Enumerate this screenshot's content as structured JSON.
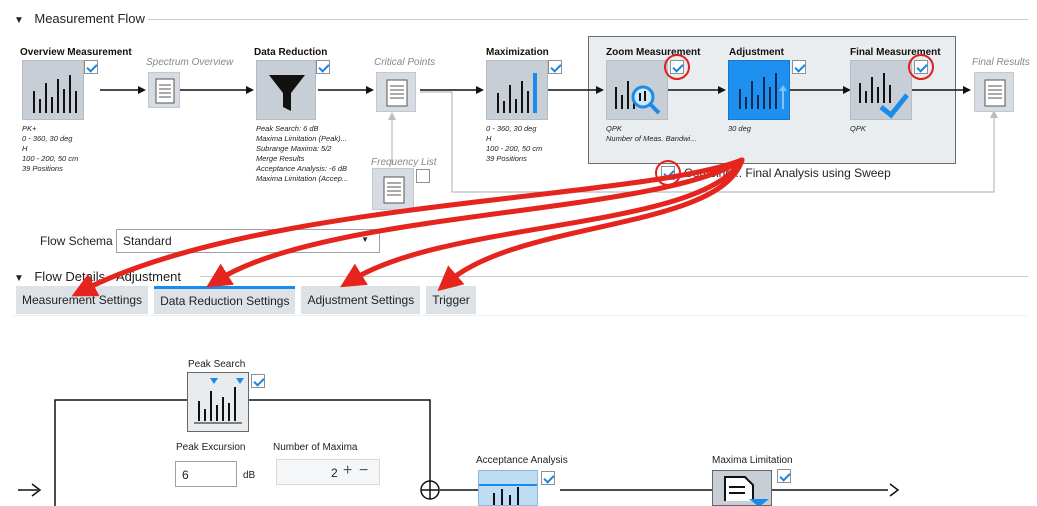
{
  "flow": {
    "section_title": "Measurement Flow",
    "nodes": {
      "overview": {
        "title": "Overview Measurement",
        "info": [
          "PK+",
          "0 - 360, 30 deg",
          "H",
          "100 - 200, 50 cm",
          "39 Positions"
        ]
      },
      "spectrum": {
        "title": "Spectrum Overview"
      },
      "datared": {
        "title": "Data Reduction",
        "info": [
          "Peak Search: 6 dB",
          "Maxima Limitation (Peak)...",
          "Subrange Maxima: 5/2",
          "Merge Results",
          "Acceptance Analysis: -6 dB",
          "Maxima Limitation (Accep..."
        ]
      },
      "critical": {
        "title": "Critical Points"
      },
      "frequency": {
        "title": "Frequency List"
      },
      "maximization": {
        "title": "Maximization",
        "info": [
          "0 - 360, 30 deg",
          "H",
          "100 - 200, 50 cm",
          "39 Positions"
        ]
      },
      "zoom": {
        "title": "Zoom Measurement",
        "info": [
          "QPK",
          "Number of Meas. Bandwi..."
        ]
      },
      "adjustment": {
        "title": "Adjustment",
        "info": [
          "30 deg"
        ]
      },
      "final": {
        "title": "Final Measurement",
        "info": [
          "QPK"
        ]
      },
      "results": {
        "title": "Final Results"
      }
    },
    "combine_label": "Combine... Final Analysis using Sweep"
  },
  "schema": {
    "label": "Flow Schema",
    "value": "Standard"
  },
  "details": {
    "section_title": "Flow Details - Adjustment",
    "tabs": [
      "Measurement Settings",
      "Data Reduction Settings",
      "Adjustment Settings",
      "Trigger"
    ],
    "active_tab": 1
  },
  "reduction": {
    "peak_search": "Peak Search",
    "peak_excursion_label": "Peak Excursion",
    "peak_excursion_value": "6",
    "peak_excursion_unit": "dB",
    "num_maxima_label": "Number of Maxima",
    "num_maxima_value": "2",
    "acceptance": "Acceptance Analysis",
    "maxima_limitation": "Maxima Limitation"
  },
  "colors": {
    "accent": "#1a8bea",
    "annotation": "#e0201a",
    "tile": "#c7ced6"
  }
}
